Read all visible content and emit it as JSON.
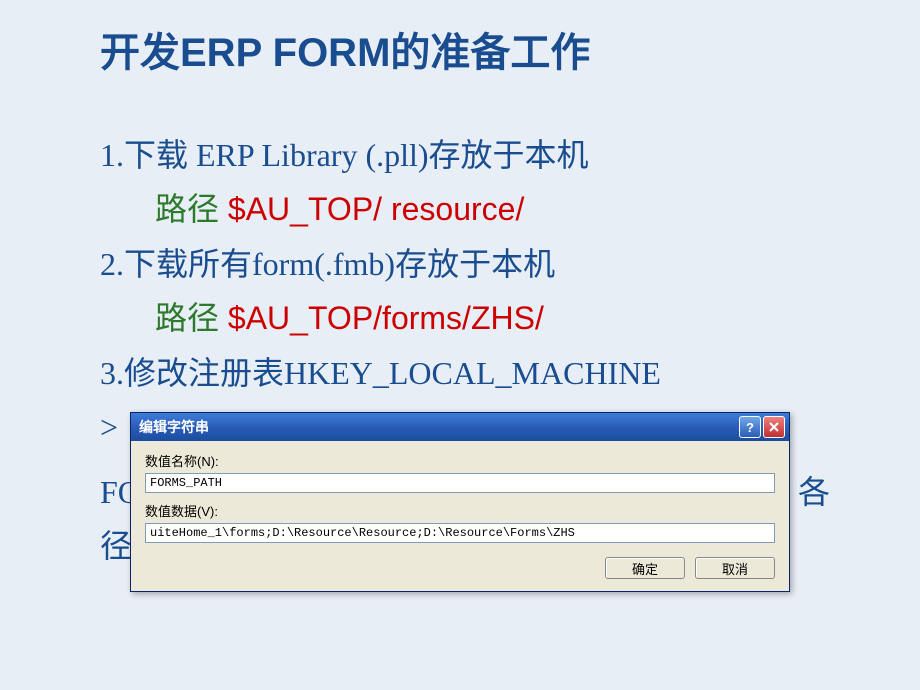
{
  "title": "开发ERP FORM的准备工作",
  "item1": "1.下载 ERP Library (.pll)存放于本机",
  "path1_label": "路径",
  "path1_value": " $AU_TOP/ resource/",
  "item2": "2.下载所有form(.fmb)存放于本机",
  "path2_label": "路径",
  "path2_value": " $AU_TOP/forms/ZHS/",
  "item3": "3.修改注册表HKEY_LOCAL_MACHINE",
  "item3_cont1": ">",
  "bg_left1": "FO",
  "bg_left2": "径",
  "bg_right": "各",
  "dialog": {
    "title": "编辑字符串",
    "name_label": "数值名称(N):",
    "name_value": "FORMS_PATH",
    "data_label": "数值数据(V):",
    "data_value": "uiteHome_1\\forms;D:\\Resource\\Resource;D:\\Resource\\Forms\\ZHS",
    "ok": "确定",
    "cancel": "取消"
  }
}
